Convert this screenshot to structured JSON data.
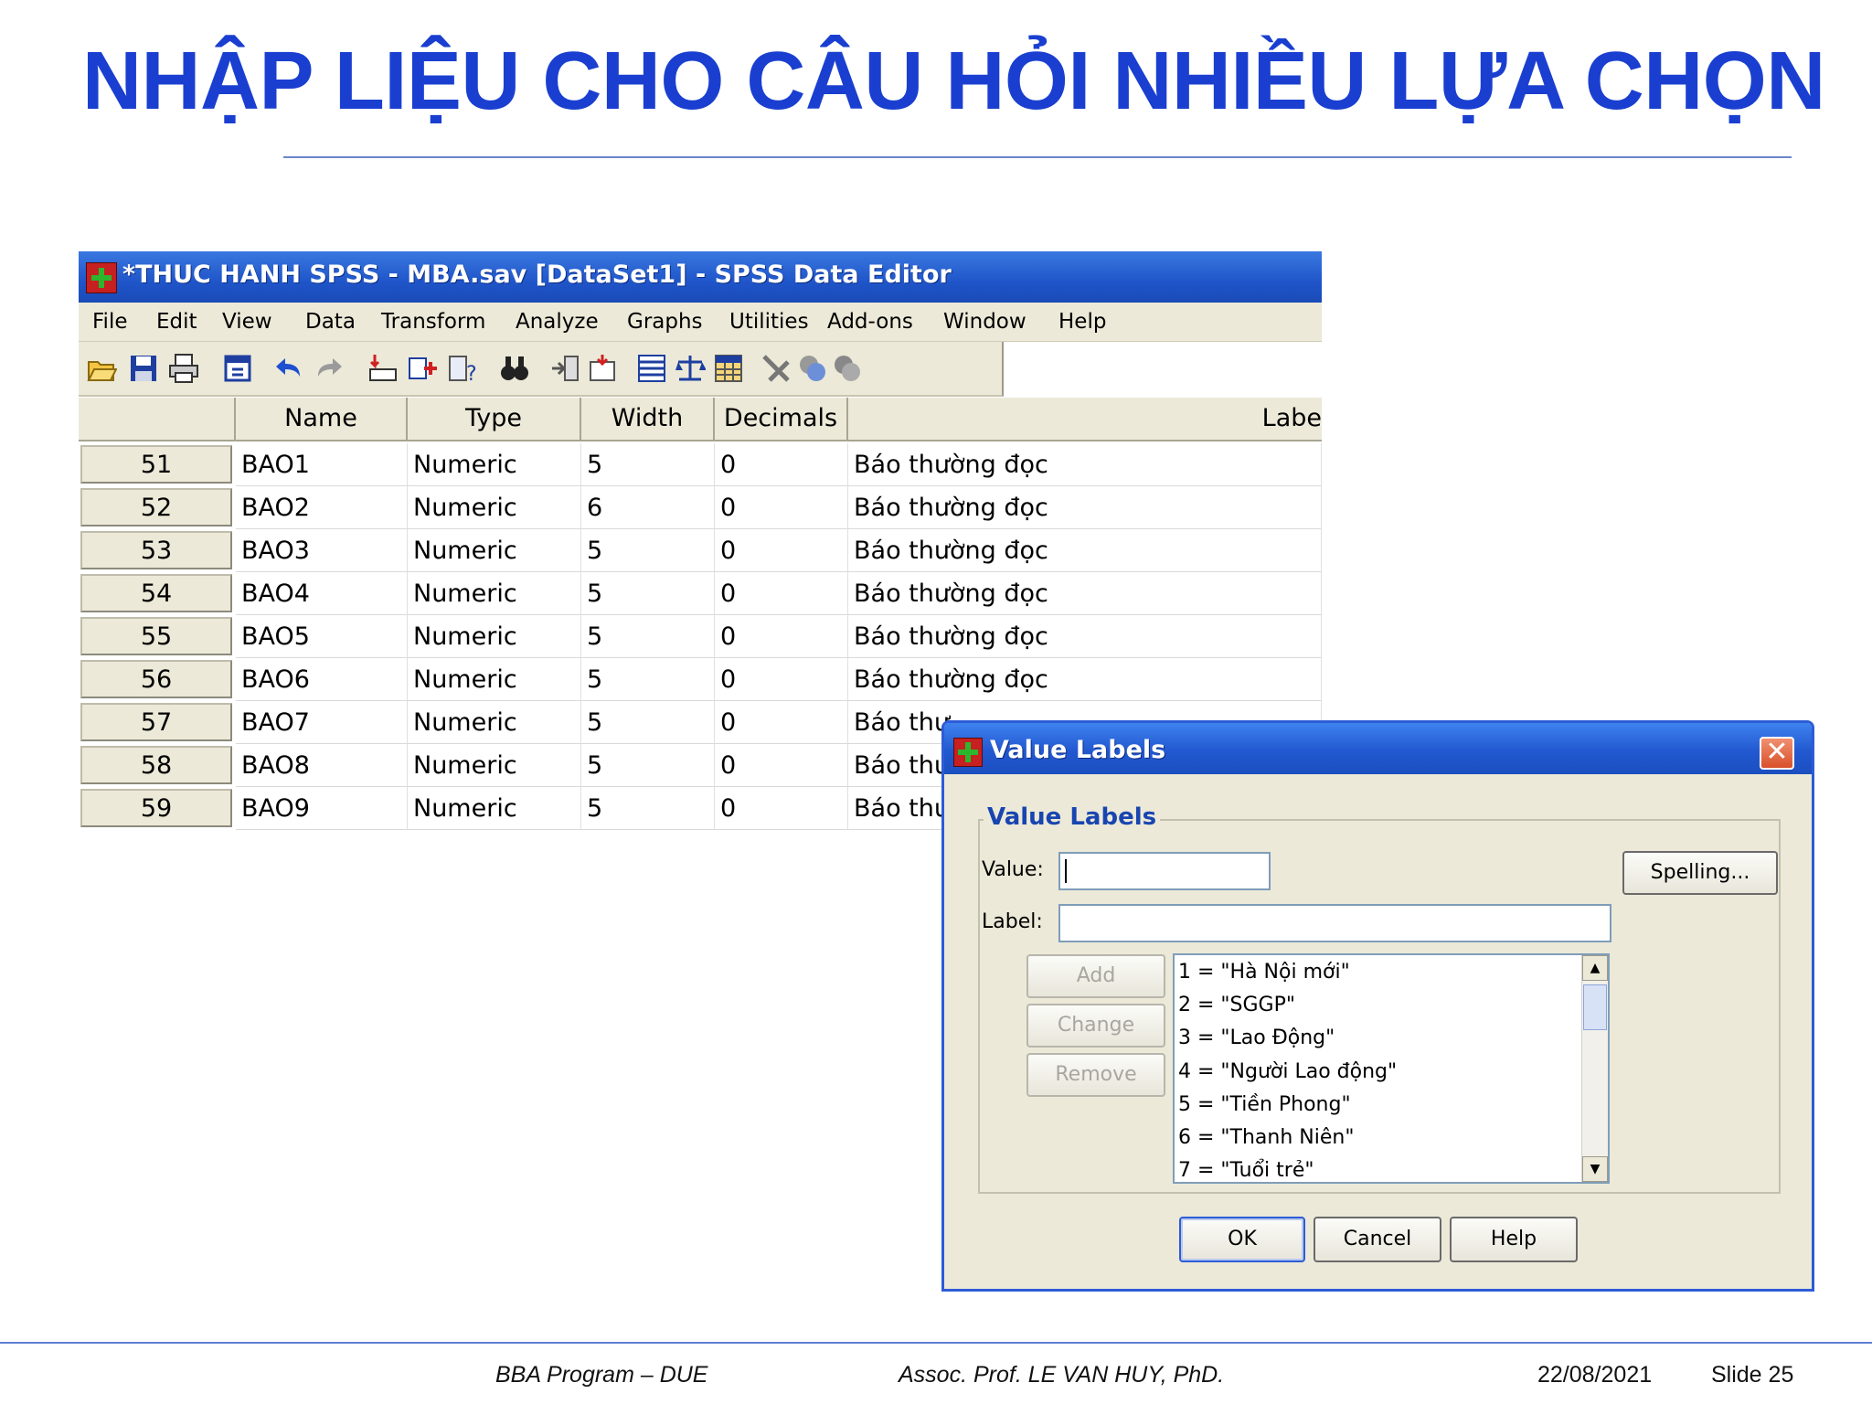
{
  "slide": {
    "title": "NHẬP LIỆU CHO CÂU HỎI NHIỀU LỰA CHỌN",
    "footer": {
      "program": "BBA Program – DUE",
      "author": "Assoc. Prof. LE VAN HUY, PhD.",
      "date": "22/08/2021",
      "slide_no": "Slide 25"
    }
  },
  "spss": {
    "title": "*THUC HANH SPSS - MBA.sav [DataSet1] - SPSS Data Editor",
    "menu": [
      "File",
      "Edit",
      "View",
      "Data",
      "Transform",
      "Analyze",
      "Graphs",
      "Utilities",
      "Add-ons",
      "Window",
      "Help"
    ],
    "toolbar_icons": [
      "open-icon",
      "save-icon",
      "print-icon",
      "dialog-recall-icon",
      "undo-icon",
      "redo-icon",
      "goto-case-icon",
      "insert-variable-icon",
      "variables-icon",
      "find-icon",
      "insert-cases-icon",
      "split-file-icon",
      "weight-cases-icon",
      "select-cases-icon",
      "value-labels-icon",
      "use-sets-icon",
      "show-all-icon"
    ],
    "columns": [
      "Name",
      "Type",
      "Width",
      "Decimals",
      "Labe"
    ],
    "rows": [
      {
        "num": "51",
        "name": "BAO1",
        "type": "Numeric",
        "width": "5",
        "decimals": "0",
        "label": "Báo thường đọc"
      },
      {
        "num": "52",
        "name": "BAO2",
        "type": "Numeric",
        "width": "6",
        "decimals": "0",
        "label": "Báo thường đọc"
      },
      {
        "num": "53",
        "name": "BAO3",
        "type": "Numeric",
        "width": "5",
        "decimals": "0",
        "label": "Báo thường đọc"
      },
      {
        "num": "54",
        "name": "BAO4",
        "type": "Numeric",
        "width": "5",
        "decimals": "0",
        "label": "Báo thường đọc"
      },
      {
        "num": "55",
        "name": "BAO5",
        "type": "Numeric",
        "width": "5",
        "decimals": "0",
        "label": "Báo thường đọc"
      },
      {
        "num": "56",
        "name": "BAO6",
        "type": "Numeric",
        "width": "5",
        "decimals": "0",
        "label": "Báo thường đọc"
      },
      {
        "num": "57",
        "name": "BAO7",
        "type": "Numeric",
        "width": "5",
        "decimals": "0",
        "label": "Báo thư"
      },
      {
        "num": "58",
        "name": "BAO8",
        "type": "Numeric",
        "width": "5",
        "decimals": "0",
        "label": "Báo thư"
      },
      {
        "num": "59",
        "name": "BAO9",
        "type": "Numeric",
        "width": "5",
        "decimals": "0",
        "label": "Báo thư"
      }
    ]
  },
  "dialog": {
    "title": "Value Labels",
    "group_label": "Value Labels",
    "value_label": "Value:",
    "value_input": "",
    "label_label": "Label:",
    "label_input": "",
    "spelling": "Spelling...",
    "add": "Add",
    "change": "Change",
    "remove": "Remove",
    "items": [
      "1 = \"Hà Nội mới\"",
      "2 = \"SGGP\"",
      "3 = \"Lao Động\"",
      "4 = \"Người Lao động\"",
      "5 = \"Tiền Phong\"",
      "6 = \"Thanh Niên\"",
      "7 = \"Tuổi trẻ\""
    ],
    "ok": "OK",
    "cancel": "Cancel",
    "help": "Help"
  }
}
